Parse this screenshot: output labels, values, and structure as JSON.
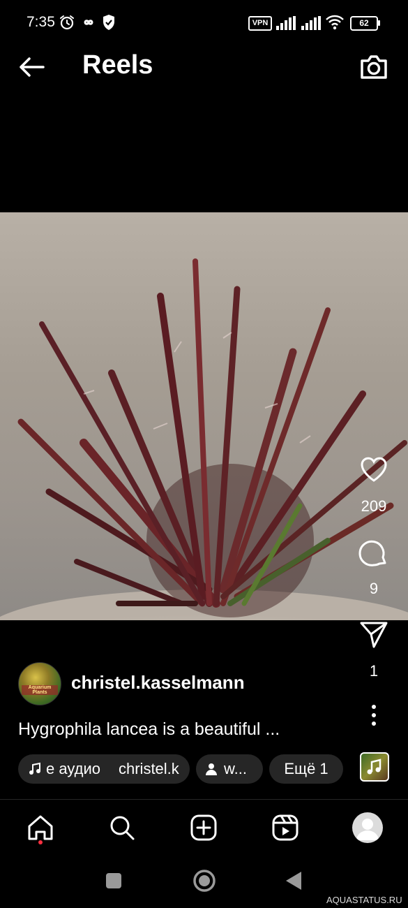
{
  "status_bar": {
    "time": "7:35",
    "vpn": "VPN",
    "battery": "62",
    "icons": [
      "alarm-icon",
      "infinity-icon",
      "shield-check-icon",
      "signal-icon",
      "signal-icon",
      "wifi-icon"
    ]
  },
  "header": {
    "title": "Reels",
    "back_icon": "arrow-left-icon",
    "camera_icon": "camera-icon"
  },
  "actions": {
    "likes": "209",
    "comments": "9",
    "shares": "1",
    "icons": [
      "heart-icon",
      "comment-icon",
      "send-icon",
      "more-vertical-icon"
    ]
  },
  "post": {
    "username": "christel.kasselmann",
    "avatar_label": "Aquarium Plants",
    "caption": "Hygrophila lancea is a beautiful ...",
    "chips": {
      "audio": "е аудио",
      "audio_author": "christel.k",
      "user": "w...",
      "more": "Ещё 1"
    }
  },
  "bottom_nav": {
    "items": [
      "home-icon",
      "search-icon",
      "create-icon",
      "reels-icon",
      "profile-icon"
    ]
  },
  "system_nav": {
    "items": [
      "recents-button",
      "home-button",
      "back-button"
    ]
  },
  "watermark": "AQUASTATUS.RU",
  "colors": {
    "background": "#000000",
    "chip_background": "#262626",
    "notification_dot": "#ff3040"
  }
}
